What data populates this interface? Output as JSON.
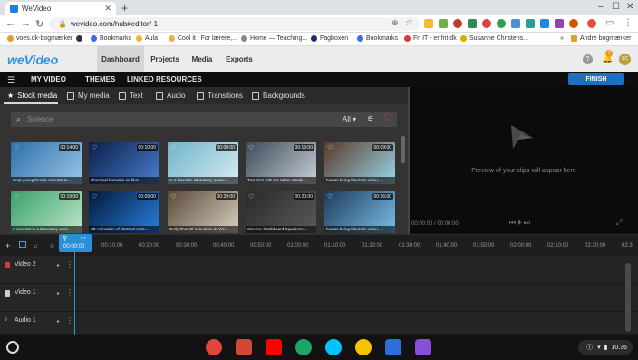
{
  "browser": {
    "tab_title": "WeVideo",
    "url": "wevideo.com/hub#editor/-1",
    "bookmarks": [
      {
        "label": "voes.dk-bogmærker",
        "color": "#e0a030"
      },
      {
        "label": "",
        "color": "#333333"
      },
      {
        "label": "Bookmarks",
        "color": "#3a6ee8"
      },
      {
        "label": "Aula",
        "color": "#f2b330"
      },
      {
        "label": "Cool it | For lærere,...",
        "color": "#e6b34a"
      },
      {
        "label": "Home — Teaching...",
        "color": "#888888"
      },
      {
        "label": "Fagboxen",
        "color": "#1d2e6e"
      },
      {
        "label": "Bookmarks",
        "color": "#3a6ee8"
      },
      {
        "label": "Fri IT - er frit.dk",
        "color": "#d83a3a"
      },
      {
        "label": "Susanne Christens...",
        "color": "#ddaa00"
      }
    ],
    "other_bookmarks": "Andre bogmærker"
  },
  "app": {
    "logo": "weVideo",
    "nav": [
      "Dashboard",
      "Projects",
      "Media",
      "Exports"
    ],
    "menu": [
      "MY VIDEO",
      "THEMES",
      "LINKED RESOURCES"
    ],
    "finish": "FINISH",
    "notif_count": "7",
    "avatar": "SC"
  },
  "media_tabs": [
    "Stock media",
    "My media",
    "Text",
    "Audio",
    "Transitions",
    "Backgrounds"
  ],
  "search": {
    "placeholder": "Science",
    "filter": "All"
  },
  "clips": [
    {
      "duration": "00:14:00",
      "caption": "Crop young female scientist lo...",
      "colors": [
        "#2b6fa8",
        "#9cc7e8"
      ]
    },
    {
      "duration": "00:10:00",
      "caption": "Chemical formulas on blue",
      "colors": [
        "#0a1d4a",
        "#4a7fcf"
      ]
    },
    {
      "duration": "00:08:00",
      "caption": "In a futuristic laboratory, a scie...",
      "colors": [
        "#6fb4c9",
        "#d8ecf3"
      ]
    },
    {
      "duration": "00:13:00",
      "caption": "Two men with the tablet standi...",
      "colors": [
        "#3d4a58",
        "#c8d0d8"
      ]
    },
    {
      "duration": "00:09:00",
      "caption": "human being futuristic vision, ...",
      "colors": [
        "#5a3a2a",
        "#9bd6e8"
      ]
    },
    {
      "duration": "00:19:00",
      "caption": "A scientist in a laboratory anal...",
      "colors": [
        "#3aa06a",
        "#bfe6c9"
      ]
    },
    {
      "duration": "00:09:00",
      "caption": "3D Animation of abstract mole...",
      "colors": [
        "#021a3a",
        "#2a7fe0"
      ]
    },
    {
      "duration": "00:29:00",
      "caption": "Dolly Shot Of Scientists do We...",
      "colors": [
        "#5a4a3a",
        "#d8d0c0"
      ]
    },
    {
      "duration": "00:20:00",
      "caption": "Science Chalkboard Equations ...",
      "colors": [
        "#2a2a2a",
        "#5a5a5a"
      ]
    },
    {
      "duration": "00:16:00",
      "caption": "human being futuristic vision, ...",
      "colors": [
        "#1e3a5a",
        "#7ac0e8"
      ]
    }
  ],
  "preview": {
    "placeholder": "Preview of your clips will appear here",
    "time": "00:00:00 / 00:00:00"
  },
  "timeline": {
    "playhead": "00:00:00",
    "ticks": [
      "00:10:00",
      "00:20:00",
      "00:30:00",
      "00:40:00",
      "00:50:00",
      "01:00:00",
      "01:10:00",
      "01:20:00",
      "01:30:00",
      "01:40:00",
      "01:50:00",
      "02:00:00",
      "02:10:00",
      "02:20:00",
      "02:3"
    ],
    "tracks": [
      {
        "label": "Video 2",
        "color": "#d33a3a"
      },
      {
        "label": "Video 1",
        "color": "#cccccc"
      },
      {
        "label": "Audio 1",
        "color": "#cccccc"
      }
    ]
  },
  "taskbar": {
    "apps": [
      {
        "name": "chrome",
        "color": "#e0463a"
      },
      {
        "name": "gmail",
        "color": "#d44638"
      },
      {
        "name": "youtube",
        "color": "#ff0000"
      },
      {
        "name": "drive",
        "color": "#1fa463"
      },
      {
        "name": "play",
        "color": "#00c4ff"
      },
      {
        "name": "keep",
        "color": "#f7c300"
      },
      {
        "name": "files",
        "color": "#2a6fdb"
      },
      {
        "name": "canvas",
        "color": "#8a4fd8"
      }
    ],
    "time": "10.36"
  }
}
